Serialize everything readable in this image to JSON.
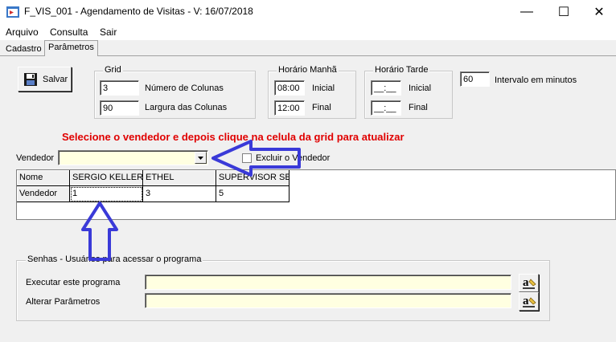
{
  "window": {
    "title": "F_VIS_001 - Agendamento de Visitas - V: 16/07/2018",
    "minimize": "—",
    "maximize": "☐",
    "close": "✕"
  },
  "menu": [
    "Arquivo",
    "Consulta",
    "Sair"
  ],
  "tabs": [
    {
      "label": "Cadastro",
      "active": false
    },
    {
      "label": "Parâmetros",
      "active": true
    }
  ],
  "save_button": {
    "label": "Salvar",
    "icon": "floppy-disk-icon"
  },
  "grid_group": {
    "title": "Grid",
    "columns_value": "3",
    "columns_label": "Número de Colunas",
    "width_value": "90",
    "width_label": "Largura das Colunas"
  },
  "morning_group": {
    "title": "Horário Manhã",
    "start_value": "08:00",
    "start_label": "Inicial",
    "end_value": "12:00",
    "end_label": "Final"
  },
  "afternoon_group": {
    "title": "Horário Tarde",
    "start_value": "__:__",
    "start_label": "Inicial",
    "end_value": "__:__",
    "end_label": "Final"
  },
  "interval": {
    "value": "60",
    "label": "Intervalo em minutos"
  },
  "instruction": "Selecione o vendedor e depois clique na celula da grid para atualizar",
  "vendor": {
    "label": "Vendedor",
    "value": "",
    "exclude_label": "Excluir o Vendedor",
    "exclude_checked": false
  },
  "vendor_grid": {
    "headers": [
      "Nome",
      "SERGIO KELLER",
      "ETHEL",
      "SUPERVISOR SE"
    ],
    "row": [
      "Vendedor",
      "1",
      "3",
      "5"
    ]
  },
  "passwords_group": {
    "title": "Senhas - Usuários para acessar o programa",
    "run_label": "Executar este programa",
    "run_value": "",
    "alter_label": "Alterar Parâmetros",
    "alter_value": "",
    "button_glyph": "a"
  },
  "colors": {
    "annotation_arrow": "#3a3ad8",
    "instruction_text": "#e00000",
    "input_yellow": "#ffffe1"
  }
}
